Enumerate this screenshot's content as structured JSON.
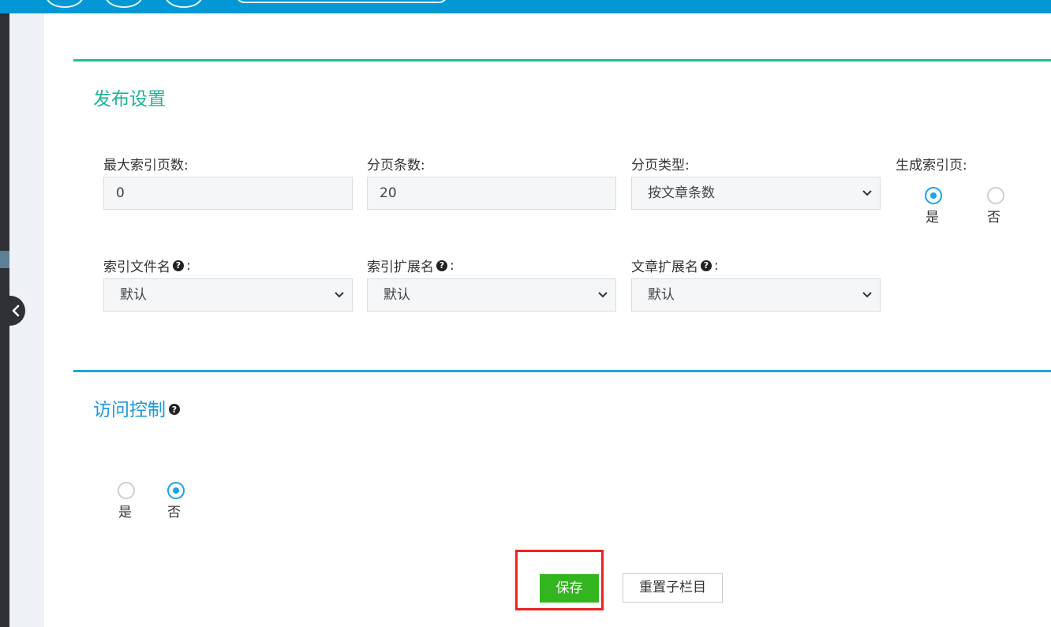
{
  "colors": {
    "header": "#0398d5",
    "sidebar": "#2f3134",
    "publish_accent": "#26b99a",
    "access_accent": "#1ea4e0",
    "radio_selected": "#1aa3e8",
    "save_button": "#33b51f",
    "highlight": "#ee2222"
  },
  "publish_settings": {
    "title": "发布设置",
    "max_index_pages": {
      "label": "最大索引页数:",
      "value": "0"
    },
    "items_per_page": {
      "label": "分页条数:",
      "value": "20"
    },
    "pagination_type": {
      "label": "分页类型:",
      "selected": "按文章条数"
    },
    "generate_index_page": {
      "label": "生成索引页:",
      "options": [
        "是",
        "否"
      ],
      "selected": "是"
    },
    "index_filename": {
      "label": "索引文件名",
      "selected": "默认",
      "help_icon": "question-circle-icon"
    },
    "index_extension": {
      "label": "索引扩展名",
      "selected": "默认",
      "help_icon": "question-circle-icon"
    },
    "article_extension": {
      "label": "文章扩展名",
      "selected": "默认",
      "help_icon": "question-circle-icon"
    },
    "label_colon": ":"
  },
  "access_control": {
    "title": "访问控制",
    "help_icon": "question-circle-icon",
    "options": [
      "是",
      "否"
    ],
    "selected": "否"
  },
  "actions": {
    "save_label": "保存",
    "reset_label": "重置子栏目"
  }
}
